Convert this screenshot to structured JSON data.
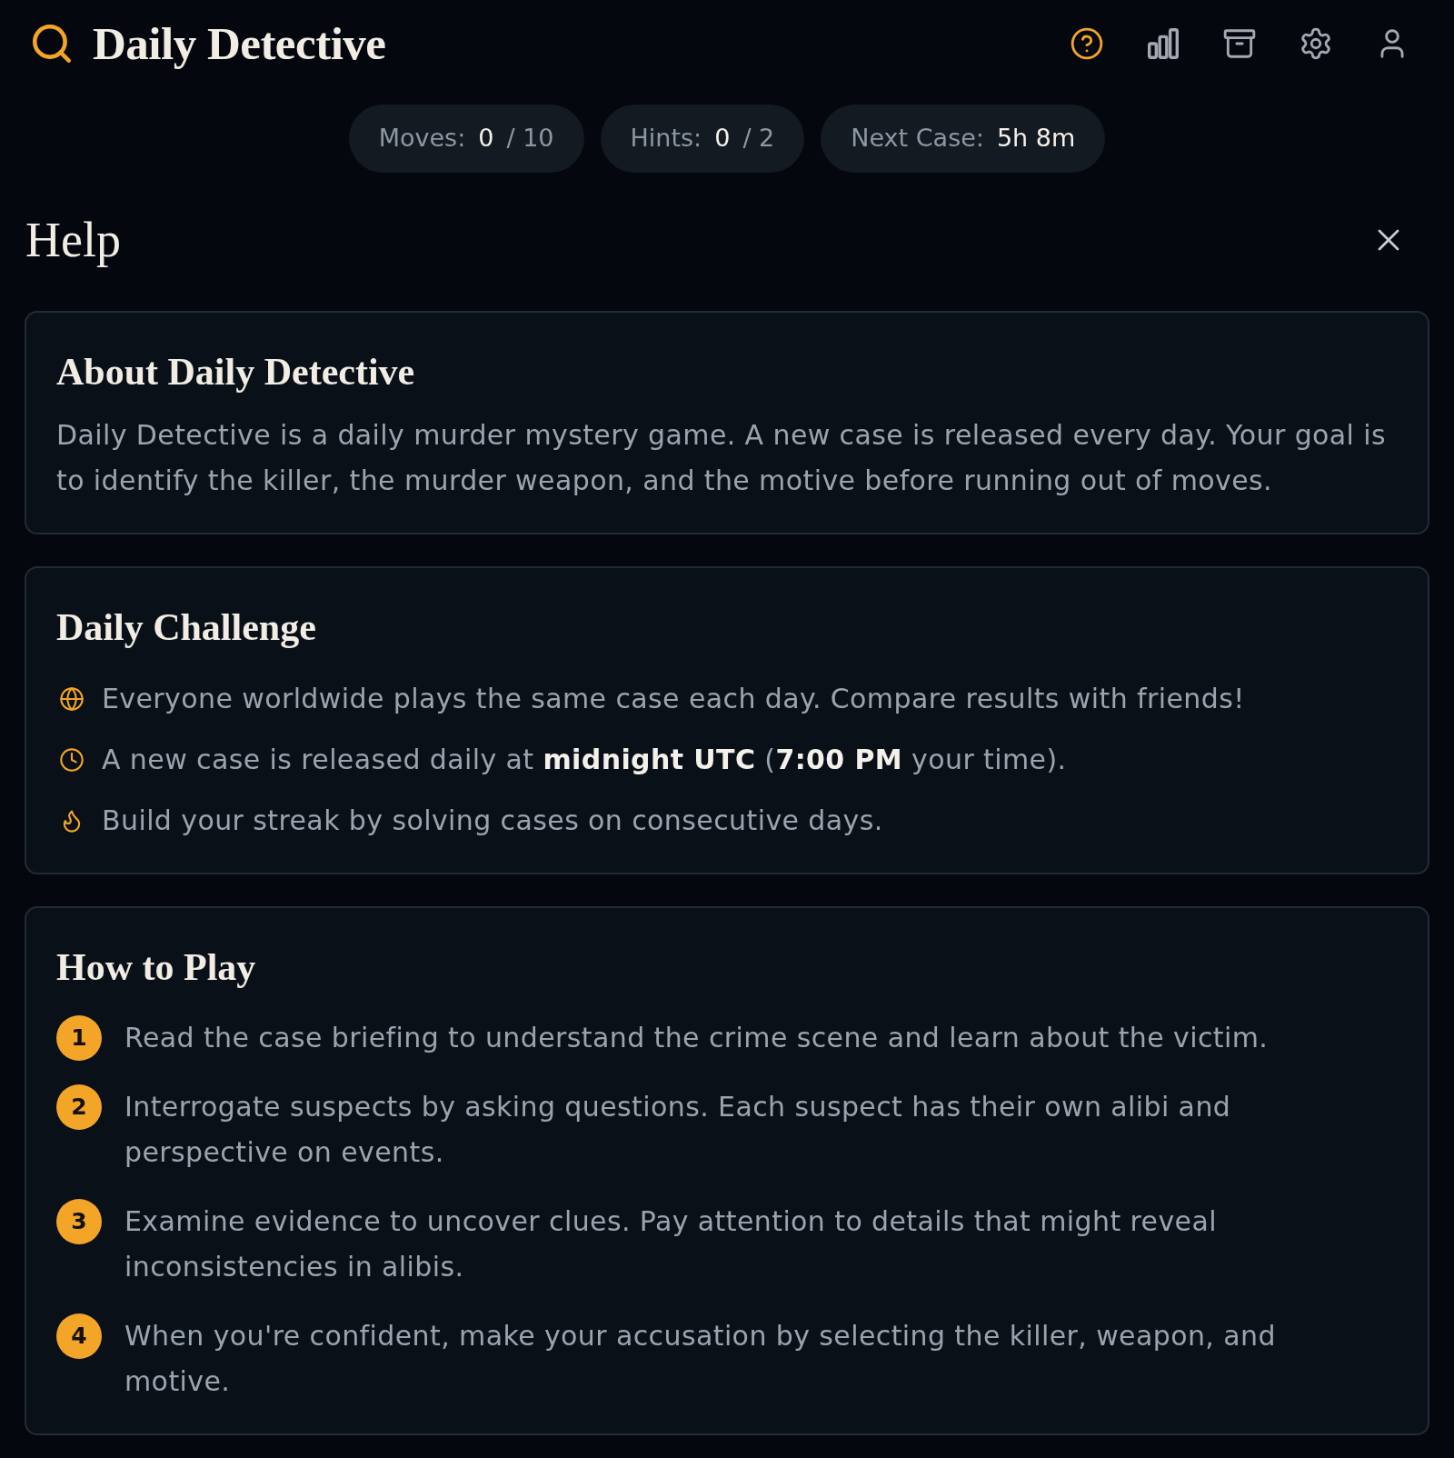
{
  "header": {
    "title": "Daily Detective",
    "nav": [
      {
        "kind": "help",
        "selected": true
      },
      {
        "kind": "stats",
        "selected": false
      },
      {
        "kind": "archive",
        "selected": false
      },
      {
        "kind": "settings",
        "selected": false
      },
      {
        "kind": "profile",
        "selected": false
      }
    ]
  },
  "stats": [
    {
      "label": "Moves:",
      "value": "0",
      "total": "/ 10"
    },
    {
      "label": "Hints:",
      "value": "0",
      "total": "/ 2"
    },
    {
      "label": "Next Case:",
      "value": "5h 8m"
    }
  ],
  "panel": {
    "title": "Help",
    "sections": [
      {
        "kind": "text",
        "title": "About Daily Detective",
        "text": "Daily Detective is a daily murder mystery game. A new case is released every day. Your goal is to identify the killer, the murder weapon, and the motive before running out of moves."
      },
      {
        "kind": "icon_list",
        "title": "Daily Challenge",
        "items": [
          {
            "kind": "globe",
            "text": "Everyone worldwide plays the same case each day. Compare results with friends!"
          },
          {
            "kind": "clock",
            "text": "A new case is released daily at **midnight UTC** (**7:00 PM** your time)."
          },
          {
            "kind": "flame",
            "text": "Build your streak by solving cases on consecutive days."
          }
        ]
      },
      {
        "kind": "steps",
        "title": "How to Play",
        "items": [
          {
            "number": "1",
            "text": "Read the case briefing to understand the crime scene and learn about the victim."
          },
          {
            "number": "2",
            "text": "Interrogate suspects by asking questions. Each suspect has their own alibi and perspective on events."
          },
          {
            "number": "3",
            "text": "Examine evidence to uncover clues. Pay attention to details that might reveal inconsistencies in alibis."
          },
          {
            "number": "4",
            "text": "When you're confident, make your accusation by selecting the killer, weapon, and motive."
          }
        ]
      }
    ]
  }
}
